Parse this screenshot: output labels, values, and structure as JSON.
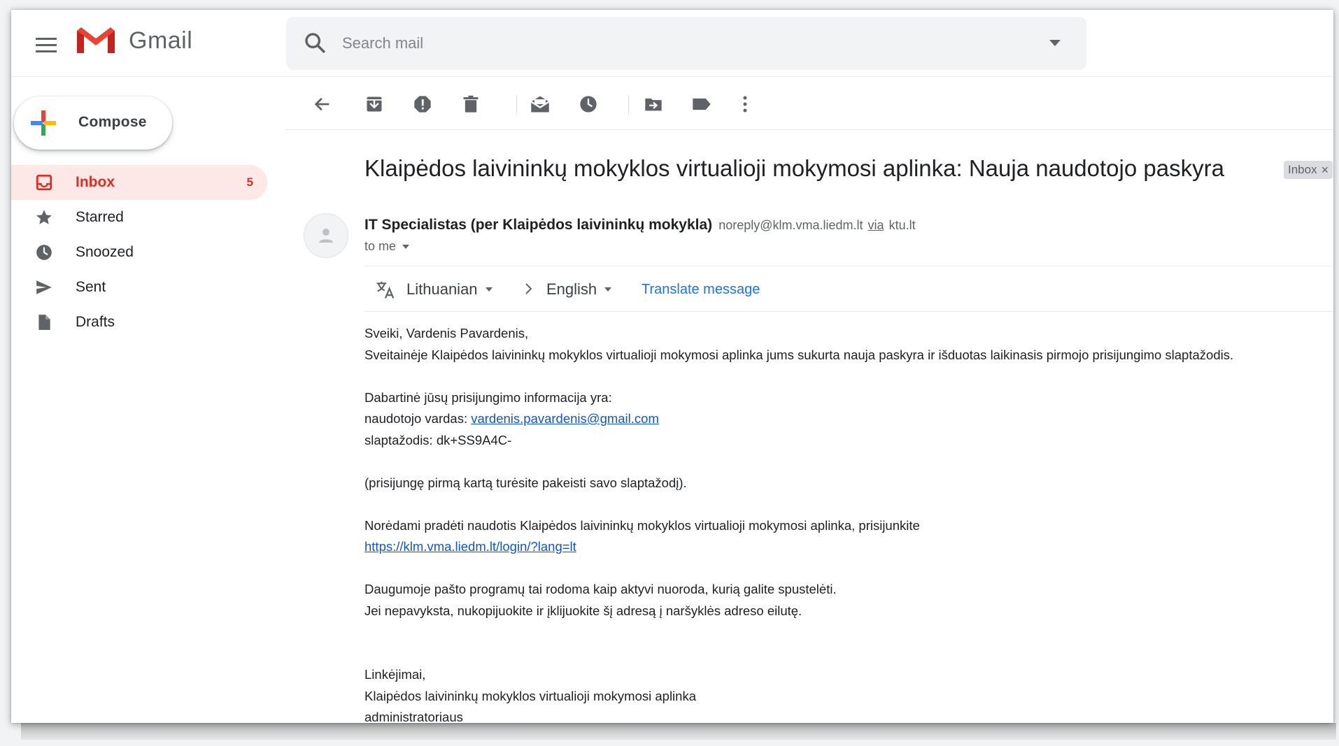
{
  "header": {
    "app_name": "Gmail",
    "search": {
      "placeholder": "Search mail"
    }
  },
  "sidebar": {
    "compose_label": "Compose",
    "items": [
      {
        "label": "Inbox",
        "icon": "inbox-icon",
        "count": "5",
        "active": true
      },
      {
        "label": "Starred",
        "icon": "star-icon"
      },
      {
        "label": "Snoozed",
        "icon": "clock-icon"
      },
      {
        "label": "Sent",
        "icon": "send-icon"
      },
      {
        "label": "Drafts",
        "icon": "draft-icon"
      }
    ]
  },
  "toolbar": {
    "buttons": [
      "back-arrow-icon",
      "archive-icon",
      "report-spam-icon",
      "delete-icon",
      "mark-unread-icon",
      "snooze-icon",
      "move-to-icon",
      "label-icon",
      "more-vert-icon"
    ]
  },
  "email": {
    "subject": "Klaipėdos laivininkų mokyklos virtualioji mokymosi aplinka: Nauja naudotojo paskyra",
    "tag": "Inbox",
    "sender_name": "IT Specialistas (per Klaipėdos laivininkų mokykla)",
    "sender_email": "noreply@klm.vma.liedm.lt",
    "via": "via",
    "via_domain": "ktu.lt",
    "to": "to me",
    "translate": {
      "from_lang": "Lithuanian",
      "to_lang": "English",
      "link": "Translate message"
    },
    "body": {
      "greeting": "Sveiki, Vardenis Pavardenis,",
      "line1": "Sveitainėje Klaipėdos laivininkų mokyklos virtualioji mokymosi aplinka jums sukurta nauja paskyra ir išduotas laikinasis pirmojo prisijungimo slaptažodis.",
      "info_header": "Dabartinė jūsų prisijungimo informacija yra:",
      "username_label": "naudotojo vardas: ",
      "username_value": "vardenis.pavardenis@gmail.com",
      "password_line": "slaptažodis: dk+SS9A4C-",
      "change_note": "(prisijungę pirmą kartą turėsite pakeisti savo slaptažodį).",
      "login_intro": "Norėdami pradėti naudotis Klaipėdos laivininkų mokyklos virtualioji mokymosi aplinka, prisijunkite",
      "login_url": "https://klm.vma.liedm.lt/login/?lang=lt",
      "note1": "Daugumoje pašto programų tai rodoma kaip aktyvi nuoroda, kurią galite spustelėti.",
      "note2": "Jei nepavyksta, nukopijuokite ir įklijuokite šį adresą į naršyklės adreso eilutę.",
      "closing": "Linkėjimai,",
      "signature1": "Klaipėdos laivininkų mokyklos virtualioji mokymosi aplinka",
      "signature2": "administratoriaus"
    }
  },
  "colors": {
    "accent_red": "#d93025",
    "active_bg": "#fce8e6",
    "link_blue": "#1a73e8",
    "icon_grey": "#5f6368"
  }
}
